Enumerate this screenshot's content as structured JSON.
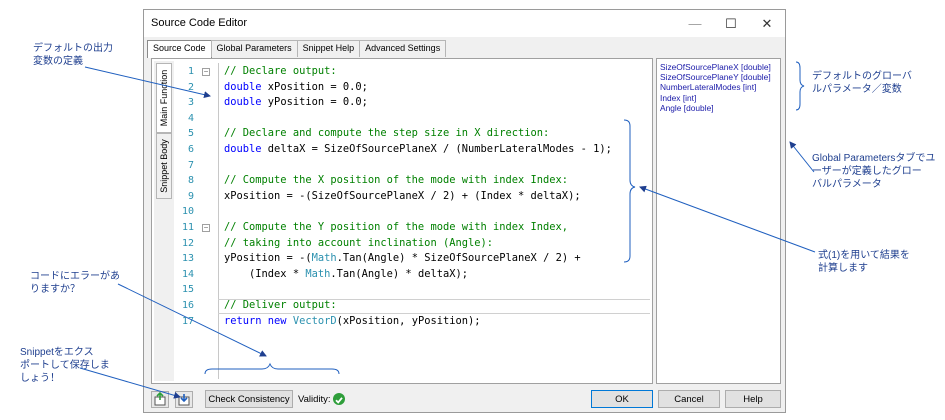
{
  "window": {
    "title": "Source Code Editor",
    "minimize": "—",
    "maximize": "☐",
    "close": "✕"
  },
  "tabs": [
    "Source Code",
    "Global Parameters",
    "Snippet Help",
    "Advanced Settings"
  ],
  "side_tabs": [
    "Main Function",
    "Snippet Body"
  ],
  "code_lines": [
    {
      "n": "1",
      "text": "// Declare output:",
      "kind": "comment"
    },
    {
      "n": "2",
      "pre": "double",
      "text": " xPosition = 0.0;",
      "kind": "kw"
    },
    {
      "n": "3",
      "pre": "double",
      "text": " yPosition = 0.0;",
      "kind": "kw"
    },
    {
      "n": "4",
      "text": "",
      "kind": "plain"
    },
    {
      "n": "5",
      "text": "// Declare and compute the step size in X direction:",
      "kind": "comment"
    },
    {
      "n": "6",
      "pre": "double",
      "text": " deltaX = SizeOfSourcePlaneX / (NumberLateralModes - 1);",
      "kind": "kw"
    },
    {
      "n": "7",
      "text": "",
      "kind": "plain"
    },
    {
      "n": "8",
      "text": "// Compute the X position of the mode with index Index:",
      "kind": "comment"
    },
    {
      "n": "9",
      "text": "xPosition = -(SizeOfSourcePlaneX / 2) + (Index * deltaX);",
      "kind": "plain"
    },
    {
      "n": "10",
      "text": "",
      "kind": "plain"
    },
    {
      "n": "11",
      "text": "// Compute the Y position of the mode with index Index,",
      "kind": "comment"
    },
    {
      "n": "12",
      "text": "// taking into account inclination (Angle):",
      "kind": "comment"
    },
    {
      "n": "13",
      "a": "yPosition = -(",
      "t": "Math",
      "b": ".Tan(Angle) * SizeOfSourcePlaneX / 2) +",
      "kind": "math"
    },
    {
      "n": "14",
      "a": "    (Index * ",
      "t": "Math",
      "b": ".Tan(Angle) * deltaX);",
      "kind": "math"
    },
    {
      "n": "15",
      "text": "",
      "kind": "plain"
    },
    {
      "n": "16",
      "text": "// Deliver output:",
      "kind": "comment"
    },
    {
      "n": "17",
      "pre": "return new",
      "t": "VectorD",
      "text": "(xPosition, yPosition);",
      "kind": "ret"
    }
  ],
  "params": [
    "SizeOfSourcePlaneX [double]",
    "SizeOfSourcePlaneY [double]",
    "NumberLateralModes [int]",
    "Index [int]",
    "Angle [double]"
  ],
  "bottom": {
    "check": "Check Consistency",
    "validity": "Validity:",
    "ok": "OK",
    "cancel": "Cancel",
    "help": "Help"
  },
  "annotations": {
    "default_output": [
      "デフォルトの出力",
      "変数の定義"
    ],
    "global_params": [
      "デフォルトのグローバ",
      "ルパラメータ／変数"
    ],
    "user_params": [
      "Global Parametersタブでユ",
      "ーザーが定義したグロー",
      "バルパラメータ"
    ],
    "compute": [
      "式(1)を用いて結果を",
      "計算します"
    ],
    "errors": [
      "コードにエラーがあ",
      "りますか？"
    ],
    "export": [
      "Snippetをエクス",
      "ポートして保存しま",
      "しょう！"
    ]
  },
  "colors": {
    "comment": "#008000",
    "keyword": "#0000ff",
    "type": "#2b91af",
    "annotation": "#1f3f8f",
    "valid": "#2e9e3a"
  }
}
